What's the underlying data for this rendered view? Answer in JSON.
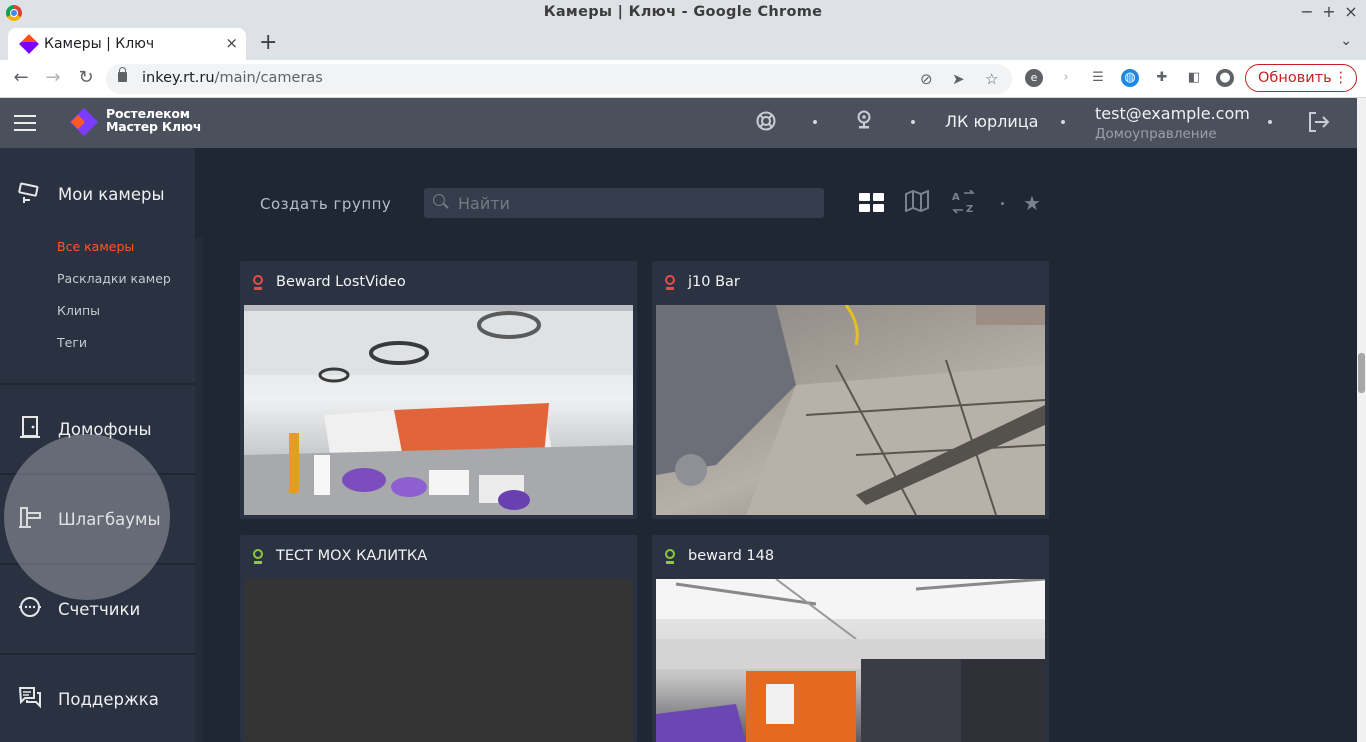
{
  "browser": {
    "window_title": "Камеры | Ключ - Google Chrome",
    "tab_title": "Камеры | Ключ",
    "url_host": "inkey.rt.ru",
    "url_path": "/main/cameras",
    "update_label": "Обновить",
    "minimize": "−",
    "maximize": "+",
    "close": "×",
    "new_tab": "+",
    "tab_close": "×"
  },
  "header": {
    "logo_line1": "Ростелеком",
    "logo_line2": "Мастер Ключ",
    "company": "ЛК юрлица",
    "email": "test@example.com",
    "org": "Домоуправление"
  },
  "sidebar": {
    "cameras_label": "Мои камеры",
    "sub_items": [
      "Все камеры",
      "Раскладки камер",
      "Клипы",
      "Теги"
    ],
    "intercoms_label": "Домофоны",
    "barriers_label": "Шлагбаумы",
    "meters_label": "Счетчики",
    "support_label": "Поддержка"
  },
  "toolbar": {
    "create_group": "Создать группу",
    "search_placeholder": "Найти"
  },
  "cameras": [
    {
      "name": "Beward LostVideo",
      "status_color": "#e84a4a"
    },
    {
      "name": "j10 Bar",
      "status_color": "#e84a4a"
    },
    {
      "name": "ТЕСТ МОХ КАЛИТКА",
      "status_color": "#8fc93a"
    },
    {
      "name": "beward 148",
      "status_color": "#8fc93a"
    }
  ],
  "colors": {
    "accent": "#ff5a1f",
    "brand_purple": "#7a3cff",
    "header_bg": "#4a505c",
    "sidebar_bg": "#2a3140",
    "main_bg": "#1f2735"
  }
}
